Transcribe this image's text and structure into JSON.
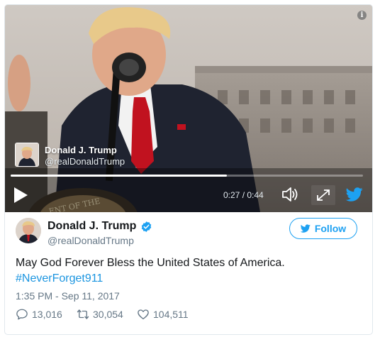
{
  "video": {
    "overlay_author_name": "Donald J. Trump",
    "overlay_author_handle": "@realDonaldTrump",
    "current_time": "0:27",
    "duration": "0:44",
    "time_display": "0:27 / 0:44",
    "progress_fraction": 0.614,
    "seal_text": "ENT OF THE"
  },
  "tweet": {
    "author_name": "Donald J. Trump",
    "author_handle": "@realDonaldTrump",
    "follow_label": "Follow",
    "text": "May God Forever Bless the United States of America.",
    "hashtag": "#NeverForget911",
    "timestamp": "1:35 PM - Sep 11, 2017"
  },
  "actions": {
    "replies": "13,016",
    "retweets": "30,054",
    "likes": "104,511"
  },
  "colors": {
    "twitter_blue": "#1da1f2",
    "link_blue": "#1b95e0",
    "secondary_text": "#657786",
    "border": "#e1e8ed"
  },
  "icons": {
    "info": "info-icon",
    "play": "play-icon",
    "volume": "volume-icon",
    "fullscreen": "fullscreen-icon",
    "twitter": "twitter-bird-icon",
    "verified": "verified-badge-icon",
    "reply": "reply-icon",
    "retweet": "retweet-icon",
    "like": "heart-icon"
  }
}
